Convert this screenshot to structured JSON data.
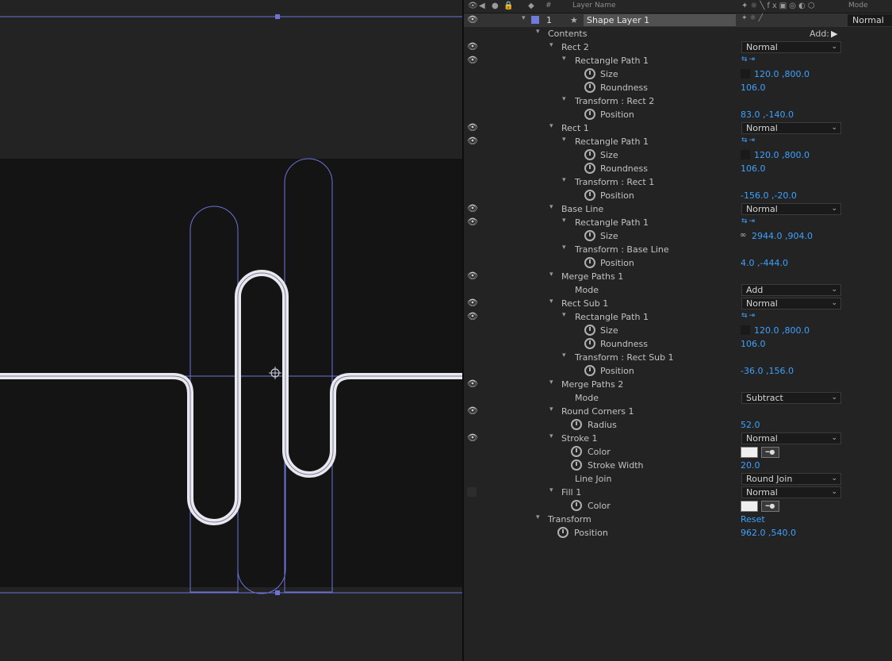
{
  "header": {
    "col_hash": "#",
    "col_layer_name": "Layer Name",
    "col_mode": "Mode",
    "switch_icons": [
      "anchor-icon",
      "sun-icon",
      "slash-icon",
      "fx-icon",
      "film-icon",
      "motion-blur-icon",
      "adjustment-icon",
      "3d-cube-icon"
    ]
  },
  "layer": {
    "number": "1",
    "name": "Shape Layer 1",
    "mode": "Normal",
    "label_color": "#6f7bd6"
  },
  "props": {
    "contents": "Contents",
    "add": "Add:",
    "rect2": "Rect 2",
    "rect2_blend": "Normal",
    "rect2_path": "Rectangle Path 1",
    "rect2_size_label": "Size",
    "rect2_size": "120.0 ,800.0",
    "rect2_round_label": "Roundness",
    "rect2_round": "106.0",
    "rect2_tf": "Transform : Rect 2",
    "rect2_pos_label": "Position",
    "rect2_pos": "83.0 ,-140.0",
    "rect1": "Rect 1",
    "rect1_blend": "Normal",
    "rect1_path": "Rectangle Path 1",
    "rect1_size_label": "Size",
    "rect1_size": "120.0 ,800.0",
    "rect1_round_label": "Roundness",
    "rect1_round": "106.0",
    "rect1_tf": "Transform : Rect 1",
    "rect1_pos_label": "Position",
    "rect1_pos": "-156.0 ,-20.0",
    "base": "Base Line",
    "base_blend": "Normal",
    "base_path": "Rectangle Path 1",
    "base_size_label": "Size",
    "base_size": "2944.0 ,904.0",
    "base_tf": "Transform : Base Line",
    "base_pos_label": "Position",
    "base_pos": "4.0 ,-444.0",
    "merge1": "Merge Paths 1",
    "merge1_mode_label": "Mode",
    "merge1_mode": "Add",
    "sub": "Rect Sub 1",
    "sub_blend": "Normal",
    "sub_path": "Rectangle Path 1",
    "sub_size_label": "Size",
    "sub_size": "120.0 ,800.0",
    "sub_round_label": "Roundness",
    "sub_round": "106.0",
    "sub_tf": "Transform : Rect Sub 1",
    "sub_pos_label": "Position",
    "sub_pos": "-36.0 ,156.0",
    "merge2": "Merge Paths 2",
    "merge2_mode_label": "Mode",
    "merge2_mode": "Subtract",
    "round": "Round Corners 1",
    "round_radius_label": "Radius",
    "round_radius": "52.0",
    "stroke": "Stroke 1",
    "stroke_blend": "Normal",
    "stroke_color_label": "Color",
    "stroke_width_label": "Stroke Width",
    "stroke_width": "20.0",
    "linejoin_label": "Line Join",
    "linejoin": "Round Join",
    "fill": "Fill 1",
    "fill_blend": "Normal",
    "fill_color_label": "Color",
    "transform": "Transform",
    "reset": "Reset",
    "tf_pos_label": "Position",
    "tf_pos": "962.0 ,540.0"
  },
  "colors": {
    "value_blue": "#3ea1ff",
    "path_outline": "#6c73d8",
    "stroke_white": "#e8e8ee",
    "panel_bg": "#232323"
  }
}
